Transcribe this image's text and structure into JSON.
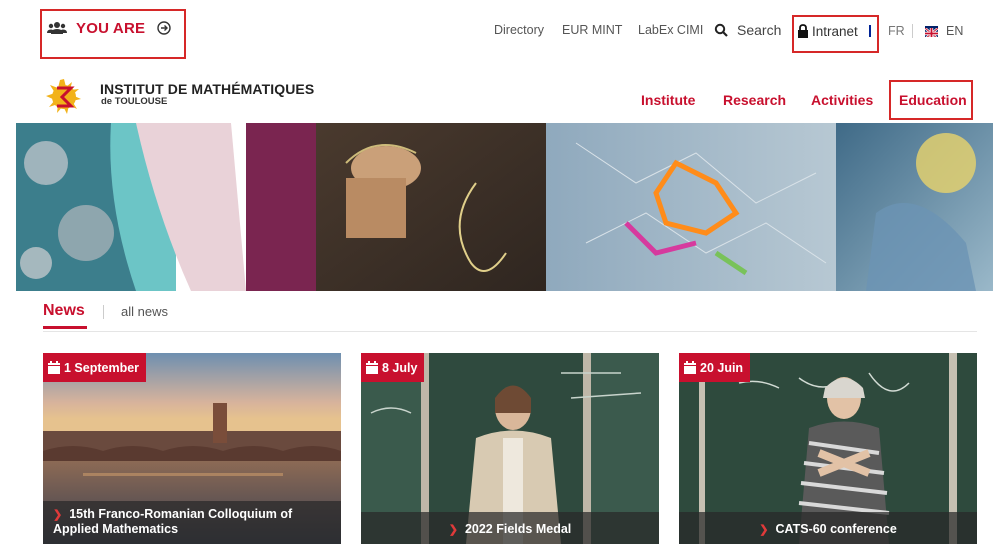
{
  "topbar": {
    "you_are_label": "YOU ARE",
    "links": [
      "Directory",
      "EUR MINT",
      "LabEx CIMI"
    ],
    "search_label": "Search",
    "intranet_label": "Intranet",
    "lang_fr": "FR",
    "lang_en": "EN"
  },
  "brand": {
    "name": "INSTITUT DE MATHÉMATIQUES",
    "subtitle": "de TOULOUSE"
  },
  "nav": {
    "items": [
      "Institute",
      "Research",
      "Activities",
      "Education"
    ]
  },
  "news": {
    "title": "News",
    "all_news": "all news",
    "cards": [
      {
        "date": "1 September",
        "caption_line1": "15th Franco-Romanian Colloquium of",
        "caption_line2": "Applied Mathematics"
      },
      {
        "date": "8 July",
        "caption": "2022 Fields Medal"
      },
      {
        "date": "20 Juin",
        "caption": "CATS-60 conference"
      }
    ]
  },
  "colors": {
    "accent": "#c8102e",
    "highlight_box": "#d62828"
  },
  "icons": {
    "you_are": "users-icon",
    "you_are_arrow": "arrow-circle-right-icon",
    "search": "search-icon",
    "intranet": "lock-icon",
    "fr": "french-flag-icon",
    "en": "uk-flag-icon",
    "date": "calendar-icon",
    "caption": "chevron-right-icon"
  }
}
